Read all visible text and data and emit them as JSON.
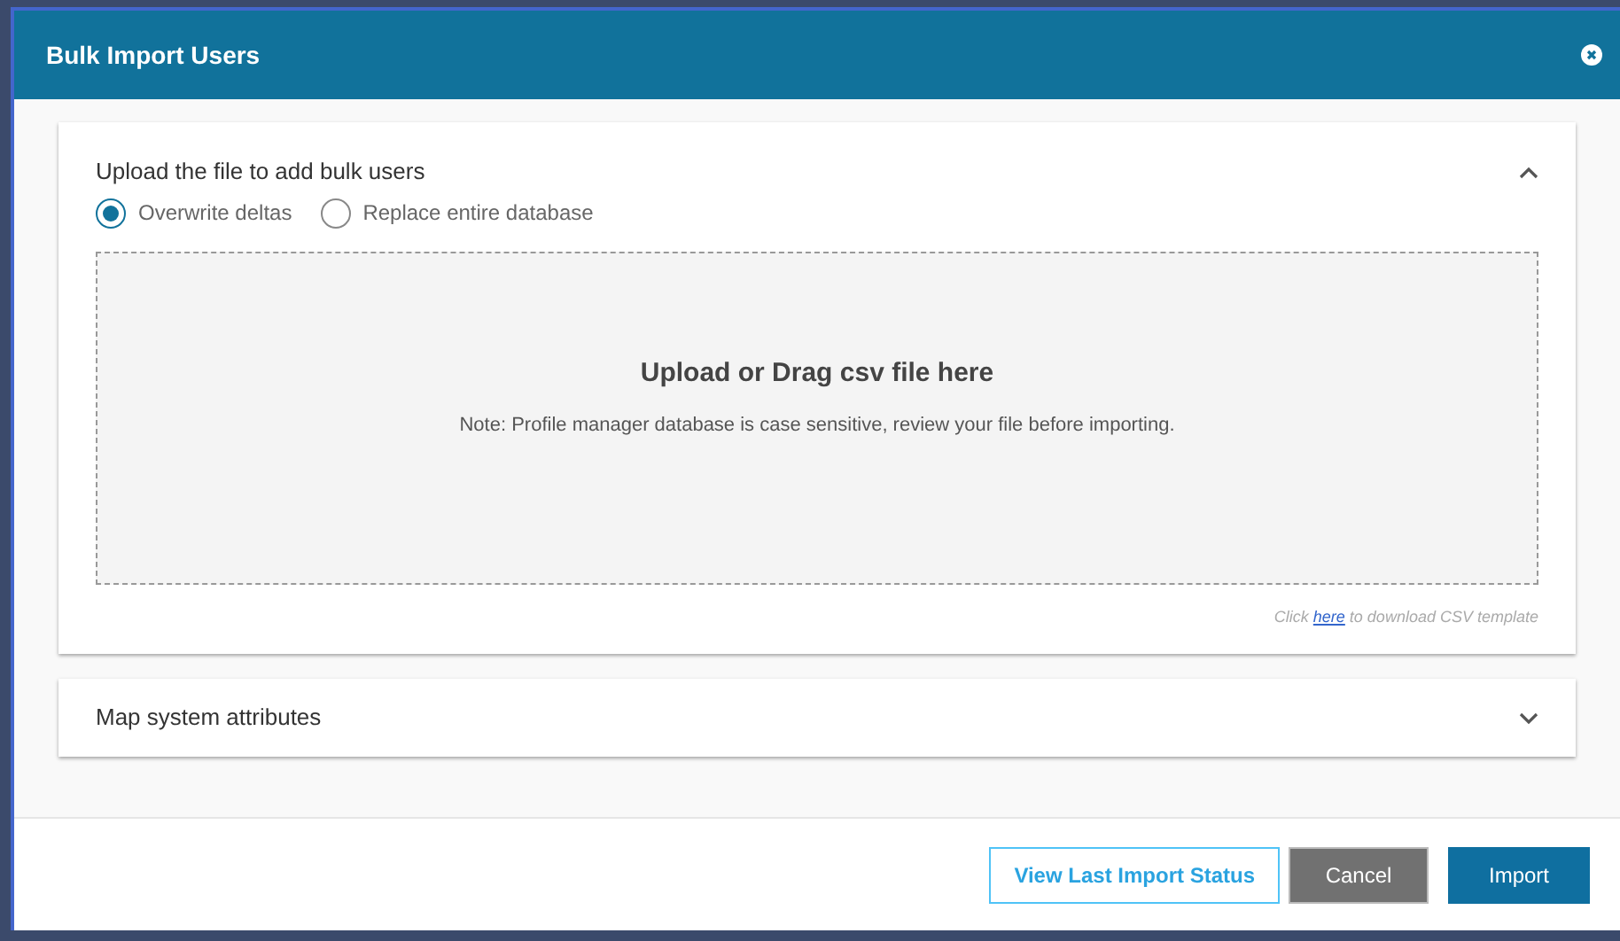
{
  "dialog": {
    "title": "Bulk Import Users"
  },
  "sections": [
    {
      "title": "Upload the file to add bulk users",
      "expanded": true,
      "options": [
        {
          "label": "Overwrite deltas",
          "selected": true
        },
        {
          "label": "Replace entire database",
          "selected": false
        }
      ],
      "dropzone": {
        "heading": "Upload or Drag csv file here",
        "note": "Note: Profile manager database is case sensitive, review your file before importing."
      },
      "template_hint": {
        "before": "Click",
        "link": "here",
        "after": "to download CSV template"
      }
    },
    {
      "title": "Map system attributes",
      "expanded": false
    }
  ],
  "buttons": [
    {
      "label": "View Last Import Status",
      "kind": "outline"
    },
    {
      "label": "Cancel",
      "kind": "secondary"
    },
    {
      "label": "Import",
      "kind": "primary"
    }
  ]
}
